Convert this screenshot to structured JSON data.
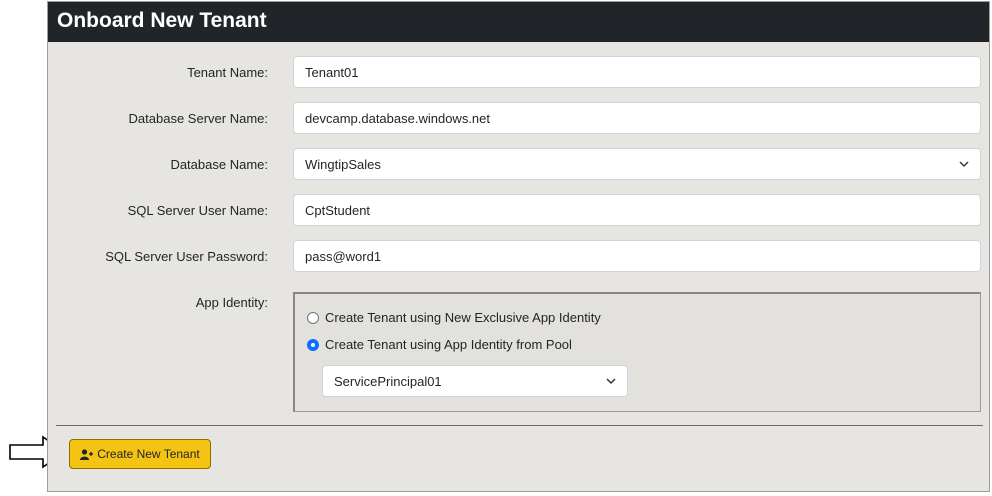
{
  "panel": {
    "title": "Onboard New Tenant"
  },
  "form": {
    "tenant_name": {
      "label": "Tenant Name:",
      "value": "Tenant01"
    },
    "db_server": {
      "label": "Database Server Name:",
      "value": "devcamp.database.windows.net"
    },
    "db_name": {
      "label": "Database Name:",
      "value": "WingtipSales"
    },
    "sql_user": {
      "label": "SQL Server User Name:",
      "value": "CptStudent"
    },
    "sql_password": {
      "label": "SQL Server User Password:",
      "value": "pass@word1"
    },
    "app_identity": {
      "label": "App Identity:",
      "options": [
        {
          "label": "Create Tenant using New Exclusive App Identity",
          "checked": false
        },
        {
          "label": "Create Tenant using App Identity from Pool",
          "checked": true
        }
      ],
      "pool_value": "ServicePrincipal01"
    }
  },
  "actions": {
    "create_label": "Create New Tenant",
    "create_icon": "user-plus-icon"
  },
  "colors": {
    "header": "#212529",
    "panel": "#e7e5e2",
    "button": "#f5c412",
    "radio_selected": "#0d6efd"
  }
}
